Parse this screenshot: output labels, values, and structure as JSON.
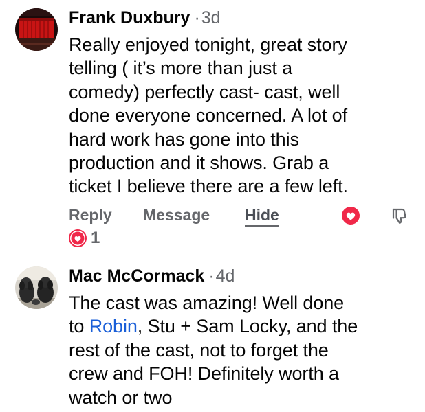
{
  "comments": [
    {
      "author": "Frank Duxbury",
      "separator": "·",
      "time": "3d",
      "text": "Really enjoyed tonight, great story\ntelling ( it’s more than just a\ncomedy) perfectly cast- cast, well\ndone everyone concerned. A lot of\nhard work has gone into this\nproduction and it shows. Grab a\nticket I believe there are a few left.",
      "actions": {
        "reply": "Reply",
        "message": "Message",
        "hide": "Hide"
      },
      "reaction": {
        "icon": "love-icon",
        "count": "1"
      }
    },
    {
      "author": "Mac McCormack",
      "separator": "·",
      "time": "4d",
      "text_before": "The cast was amazing! Well done\nto ",
      "mention": "Robin",
      "text_after": ", Stu + Sam Locky, and the\nrest of the cast, not to forget the\ncrew and FOH! Definitely worth a\nwatch or two"
    }
  ],
  "colors": {
    "text": "#050505",
    "meta": "#65676b",
    "mention": "#1a5fd8",
    "love": "#f02849"
  }
}
